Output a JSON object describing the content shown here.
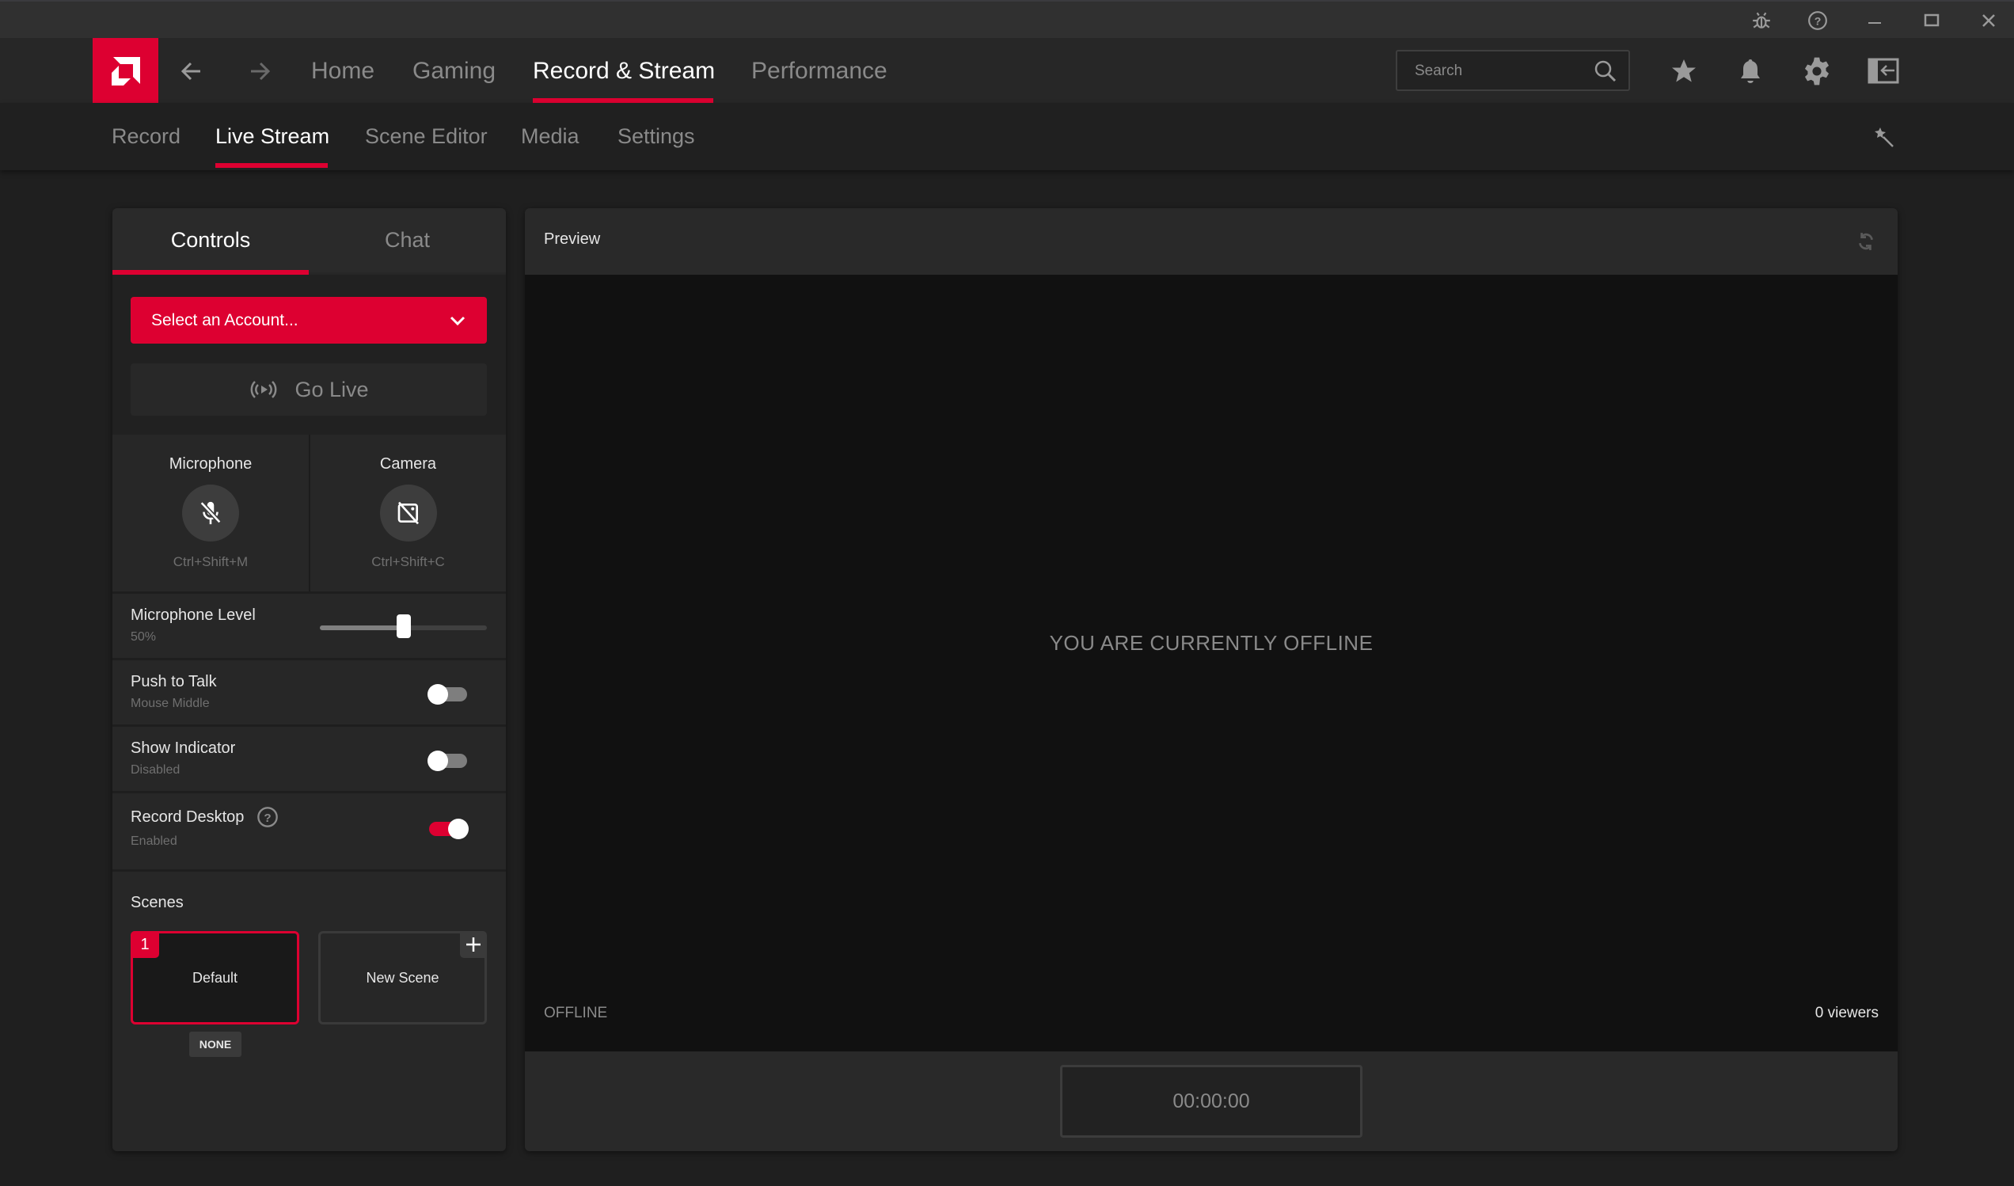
{
  "window": {
    "title_bar_icons": [
      "bug-icon",
      "help-icon",
      "minimize-icon",
      "maximize-icon",
      "close-icon"
    ]
  },
  "topnav": {
    "logo": "amd-logo",
    "items": [
      {
        "label": "Home",
        "active": false
      },
      {
        "label": "Gaming",
        "active": false
      },
      {
        "label": "Record & Stream",
        "active": true
      },
      {
        "label": "Performance",
        "active": false
      }
    ],
    "search": {
      "placeholder": "Search",
      "value": ""
    },
    "icons": [
      "star-icon",
      "bell-icon",
      "gear-icon",
      "exit-panel-icon"
    ]
  },
  "subnav": {
    "items": [
      {
        "label": "Record",
        "active": false
      },
      {
        "label": "Live Stream",
        "active": true
      },
      {
        "label": "Scene Editor",
        "active": false
      },
      {
        "label": "Media",
        "active": false
      },
      {
        "label": "Settings",
        "active": false
      }
    ]
  },
  "controls": {
    "tabs": [
      {
        "label": "Controls",
        "active": true
      },
      {
        "label": "Chat",
        "active": false
      }
    ],
    "account_select": "Select an Account...",
    "go_live": "Go Live",
    "microphone": {
      "label": "Microphone",
      "hotkey": "Ctrl+Shift+M",
      "muted": true
    },
    "camera": {
      "label": "Camera",
      "hotkey": "Ctrl+Shift+C",
      "disabled": true
    },
    "mic_level": {
      "label": "Microphone Level",
      "value_text": "50%",
      "value": 50
    },
    "push_to_talk": {
      "label": "Push to Talk",
      "sub": "Mouse Middle",
      "on": false
    },
    "show_indicator": {
      "label": "Show Indicator",
      "sub": "Disabled",
      "on": false
    },
    "record_desktop": {
      "label": "Record Desktop",
      "sub": "Enabled",
      "on": true
    },
    "scenes": {
      "title": "Scenes",
      "items": [
        {
          "number": "1",
          "label": "Default",
          "selected": true,
          "hotkey_badge": "NONE"
        },
        {
          "label": "New Scene",
          "add": true
        }
      ]
    }
  },
  "preview": {
    "title": "Preview",
    "message": "YOU ARE CURRENTLY OFFLINE",
    "status": "OFFLINE",
    "viewers": "0 viewers",
    "timer": "00:00:00"
  },
  "colors": {
    "accent": "#dd0031",
    "background": "#1f1f1f",
    "panel": "#272727",
    "screen": "#111111"
  }
}
